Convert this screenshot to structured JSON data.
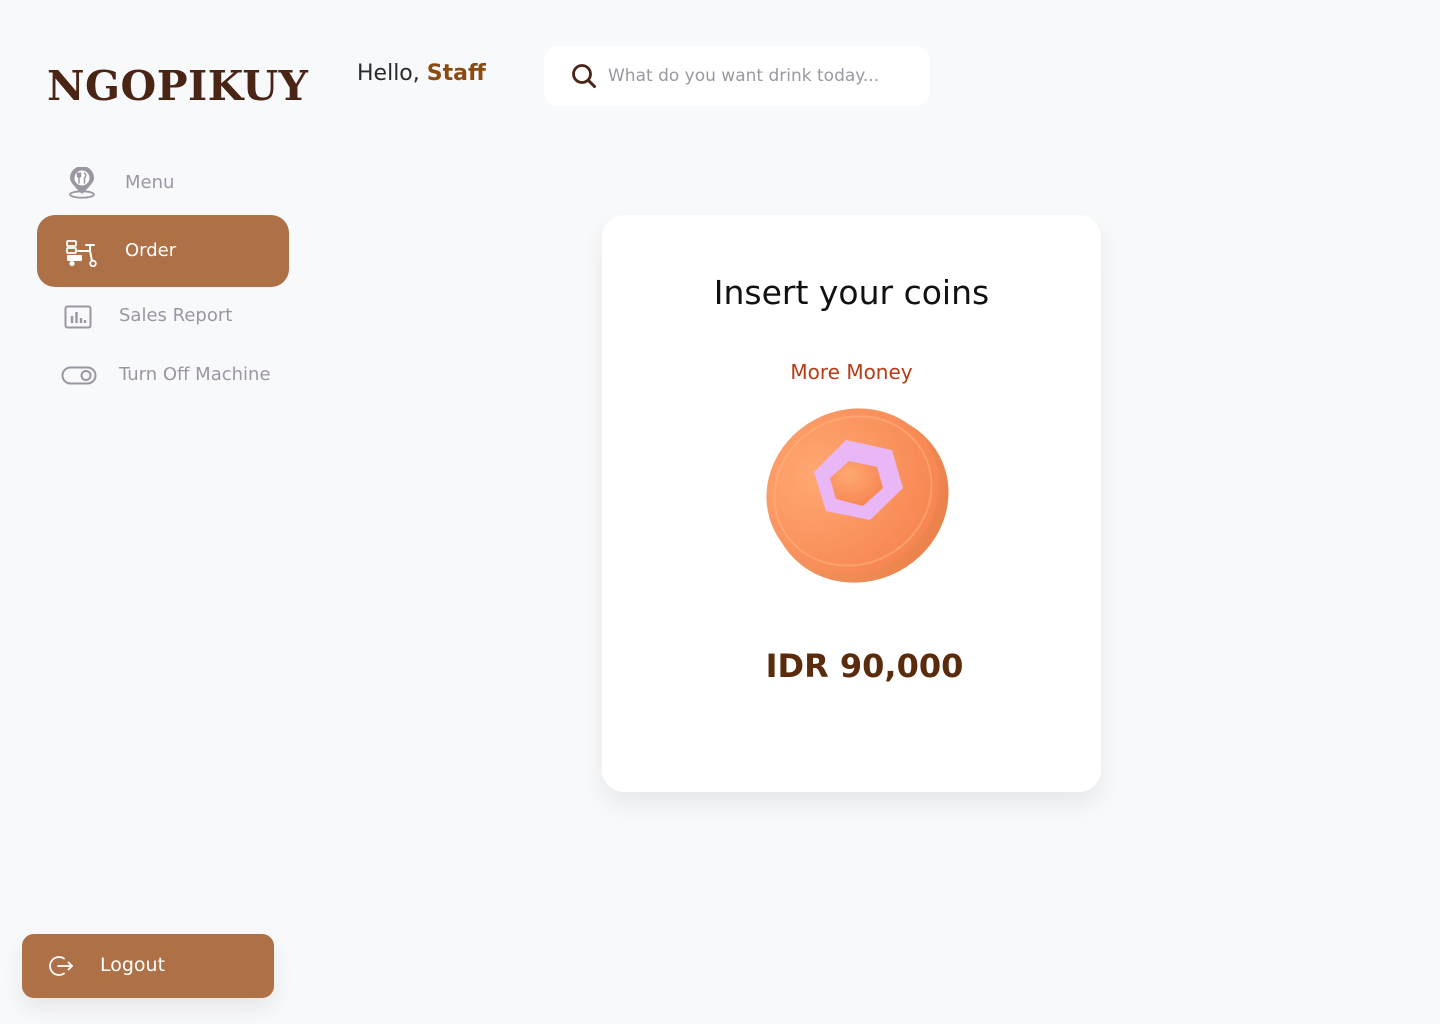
{
  "app": {
    "brand": "NGOPIKUY"
  },
  "header": {
    "greeting_prefix": "Hello, ",
    "greeting_name": "Staff",
    "search_placeholder": "What do you want drink today..."
  },
  "sidebar": {
    "items": [
      {
        "label": "Menu",
        "icon": "food-location-icon",
        "active": false
      },
      {
        "label": "Order",
        "icon": "delivery-cart-icon",
        "active": true
      },
      {
        "label": "Sales Report",
        "icon": "bar-chart-icon",
        "active": false
      },
      {
        "label": "Turn Off Machine",
        "icon": "toggle-icon",
        "active": false
      }
    ],
    "logout_label": "Logout"
  },
  "card": {
    "title": "Insert your coins",
    "more_money": "More Money",
    "amount": "IDR 90,000"
  },
  "colors": {
    "brand": "#4a2415",
    "accent": "#ad7047",
    "greeting_name": "#8a4a12",
    "more_money": "#b83a16",
    "amount": "#5a2b0c",
    "coin": "#f98f5c",
    "coin_symbol": "#e6b3f5"
  }
}
